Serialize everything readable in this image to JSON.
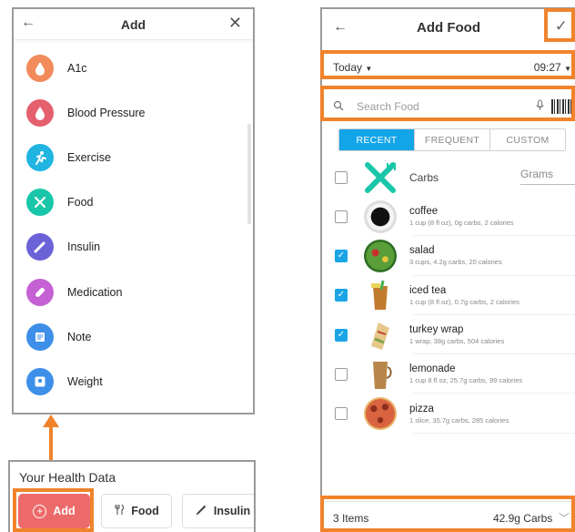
{
  "add_panel": {
    "title": "Add",
    "back_glyph": "←",
    "close_glyph": "✕",
    "items": [
      {
        "label": "A1c",
        "icon": "a1c-drop-icon",
        "color": "#f28b5b",
        "glyph": "●"
      },
      {
        "label": "Blood Pressure",
        "icon": "blood-drop-icon",
        "color": "#e4606d",
        "glyph": "▲"
      },
      {
        "label": "Exercise",
        "icon": "running-icon",
        "color": "#1fb5e0",
        "glyph": "✦"
      },
      {
        "label": "Food",
        "icon": "fork-knife-icon",
        "color": "#19c7a8",
        "glyph": "✕"
      },
      {
        "label": "Insulin",
        "icon": "syringe-icon",
        "color": "#6a63d8",
        "glyph": "✎"
      },
      {
        "label": "Medication",
        "icon": "pill-icon",
        "color": "#c561d4",
        "glyph": "⬭"
      },
      {
        "label": "Note",
        "icon": "note-icon",
        "color": "#3d8fe8",
        "glyph": "≡"
      },
      {
        "label": "Weight",
        "icon": "scale-icon",
        "color": "#3d8fe8",
        "glyph": "▣"
      }
    ]
  },
  "health": {
    "title": "Your Health Data",
    "buttons": {
      "add": {
        "label": "Add",
        "glyph": "+"
      },
      "food": {
        "label": "Food",
        "glyph": "🍴"
      },
      "insulin": {
        "label": "Insulin",
        "glyph": "✎"
      }
    }
  },
  "food_panel": {
    "title": "Add Food",
    "back_glyph": "←",
    "check_glyph": "✓",
    "date": "Today",
    "time": "09:27",
    "search_placeholder": "Search Food",
    "tabs": [
      "RECENT",
      "FREQUENT",
      "CUSTOM"
    ],
    "carbs_header": "Carbs",
    "unit": "Grams",
    "foods": [
      {
        "name": "coffee",
        "desc": "1 cup (8 fl oz), 0g carbs, 2 calories",
        "checked": false,
        "icon": "coffee-cup-icon",
        "color": "#2b2b2b"
      },
      {
        "name": "salad",
        "desc": "3 cups, 4.2g carbs, 20 calories",
        "checked": true,
        "icon": "salad-icon",
        "color": "#5a9e3a"
      },
      {
        "name": "iced tea",
        "desc": "1 cup (8 fl oz), 0.7g carbs, 2 calories",
        "checked": true,
        "icon": "iced-tea-icon",
        "color": "#c27b2e"
      },
      {
        "name": "turkey wrap",
        "desc": "1 wrap, 38g carbs, 504 calories",
        "checked": true,
        "icon": "wrap-icon",
        "color": "#d9b36a"
      },
      {
        "name": "lemonade",
        "desc": "1 cup 8 fl oz, 25.7g carbs, 99 calories",
        "checked": false,
        "icon": "lemonade-icon",
        "color": "#b8864a"
      },
      {
        "name": "pizza",
        "desc": "1 slice, 35.7g carbs, 285 calories",
        "checked": false,
        "icon": "pizza-icon",
        "color": "#c9553a"
      }
    ],
    "footer_count": "3 Items",
    "footer_total": "42.9g Carbs"
  },
  "colors": {
    "accent": "#f0832c",
    "tab_active": "#12a5e8",
    "checkbox": "#1aa4e6",
    "add_button": "#ed6a6a"
  }
}
